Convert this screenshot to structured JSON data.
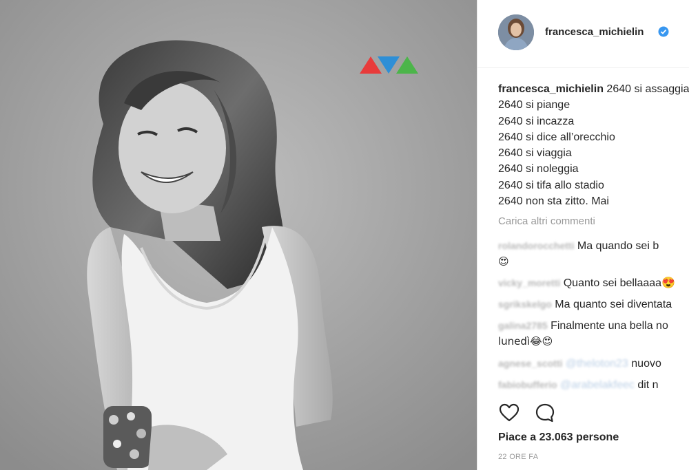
{
  "post": {
    "username": "francesca_michielin",
    "verified": true,
    "caption_lines": [
      "2640 si assaggia",
      "2640 si piange",
      "2640 si incazza",
      "2640 si dice all’orecchio",
      "2640 si viaggia",
      "2640 si noleggia",
      "2640 si tifa allo stadio",
      "2640 non sta zitto. Mai"
    ],
    "load_more": "Carica altri commenti",
    "comments": [
      {
        "user": "rolandorocchetti",
        "text": "Ma quando sei b",
        "text2": "😍"
      },
      {
        "user": "vicky_moretti",
        "text": "Quanto sei bellaaaa😍"
      },
      {
        "user": "sgrikskelgo",
        "text": "Ma quanto sei diventata"
      },
      {
        "user": "galina2785",
        "text": "Finalmente una bella no",
        "text2": "lunedì😂😍"
      },
      {
        "user": "agnese_scotti",
        "mention": "@theloton23",
        "text": "nuovo"
      },
      {
        "user": "fabiobufferio",
        "mention": "@arabelakfeec",
        "text": "dit n"
      }
    ],
    "likes": "Piace a 23.063 persone",
    "time": "22 ORE FA"
  },
  "icons": {
    "like": "heart-outline-icon",
    "comment": "comment-bubble-icon",
    "verified": "verified-badge-icon"
  },
  "colors": {
    "verified_blue": "#3897f0",
    "logo_red": "#e83b3b",
    "logo_blue": "#2e8fd6",
    "logo_green": "#4cb54a"
  }
}
